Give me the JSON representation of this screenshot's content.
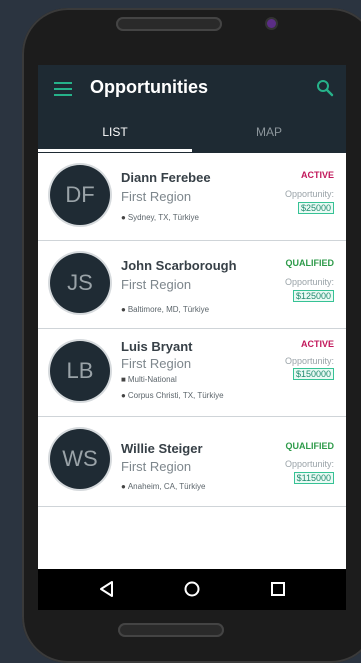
{
  "app": {
    "title": "Opportunities"
  },
  "tabs": [
    {
      "label": "LIST",
      "active": true
    },
    {
      "label": "MAP",
      "active": false
    }
  ],
  "colors": {
    "accent": "#26b28a",
    "appbar": "#1e2a33",
    "active": "#c2185b",
    "qualified": "#2e9b4a"
  },
  "opportunities": [
    {
      "initials": "DF",
      "name": "Diann Ferebee",
      "region": "First Region",
      "location": "Sydney, TX, Türkiye",
      "status": "ACTIVE",
      "opportunity_label": "Opportunity:",
      "amount": "$25000"
    },
    {
      "initials": "JS",
      "name": "John Scarborough",
      "region": "First Region",
      "location": "Baltimore, MD, Türkiye",
      "status": "QUALIFIED",
      "opportunity_label": "Opportunity:",
      "amount": "$125000"
    },
    {
      "initials": "LB",
      "name": "Luis Bryant",
      "region": "First Region",
      "segment": "Multi-National",
      "location": "Corpus Christi, TX, Türkiye",
      "status": "ACTIVE",
      "opportunity_label": "Opportunity:",
      "amount": "$150000"
    },
    {
      "initials": "WS",
      "name": "Willie Steiger",
      "region": "First Region",
      "location": "Anaheim, CA, Türkiye",
      "status": "QUALIFIED",
      "opportunity_label": "Opportunity:",
      "amount": "$115000"
    }
  ],
  "navbar": {
    "back": "back-icon",
    "home": "home-icon",
    "recents": "recents-icon"
  }
}
